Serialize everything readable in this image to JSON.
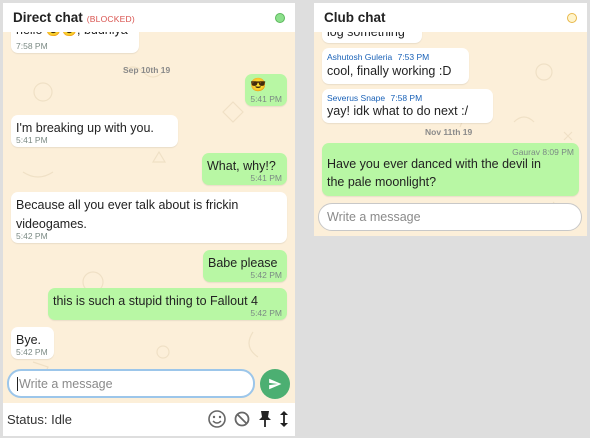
{
  "direct_chat": {
    "title": "Direct chat",
    "blocked_tag": "(BLOCKED)",
    "top_partial": {
      "text": "hello 😎😎, budhiya",
      "time": "7:58 PM"
    },
    "date_separator": "Sep 10th 19",
    "messages": [
      {
        "dir": "out",
        "text": "😎",
        "time": "5:41 PM"
      },
      {
        "dir": "in",
        "text": "I'm breaking up with you.",
        "time": "5:41 PM"
      },
      {
        "dir": "out",
        "text": "What, why!?",
        "time": "5:41 PM"
      },
      {
        "dir": "in",
        "text_lines": [
          "Because all you ever talk about is frickin",
          "videogames."
        ],
        "time": "5:42 PM"
      },
      {
        "dir": "out",
        "text": "Babe please",
        "time": "5:42 PM"
      },
      {
        "dir": "out",
        "text": "this is such a stupid thing to Fallout 4",
        "time": "5:42 PM"
      },
      {
        "dir": "in",
        "text": "Bye.",
        "time": "5:42 PM"
      }
    ],
    "composer": {
      "placeholder": "Write a message"
    },
    "status": "Status: Idle",
    "icons": [
      "emoji-icon",
      "block-icon",
      "pin-icon",
      "resize-icon"
    ]
  },
  "club_chat": {
    "title": "Club chat",
    "top_partial": {
      "text": "log something"
    },
    "date_separator": "Nov 11th 19",
    "messages": [
      {
        "dir": "in",
        "sender": "Ashutosh Guleria",
        "sender_time": "7:53 PM",
        "text": "cool, finally working :D"
      },
      {
        "dir": "in",
        "sender": "Severus Snape",
        "sender_time": "7:58 PM",
        "text": "yay! idk what to do next :/"
      },
      {
        "dir": "out",
        "sender": "Gaurav",
        "sender_time": "8:09 PM",
        "text_lines": [
          "Have you ever danced with the devil in",
          "the pale moonlight?"
        ]
      }
    ],
    "composer": {
      "placeholder": "Write a message"
    }
  },
  "colors": {
    "chat_bg": "#fcefd9",
    "out_bubble": "#b8f7a4",
    "in_bubble": "#ffffff",
    "accent": "#4caf72",
    "blocked": "#d9534f"
  }
}
